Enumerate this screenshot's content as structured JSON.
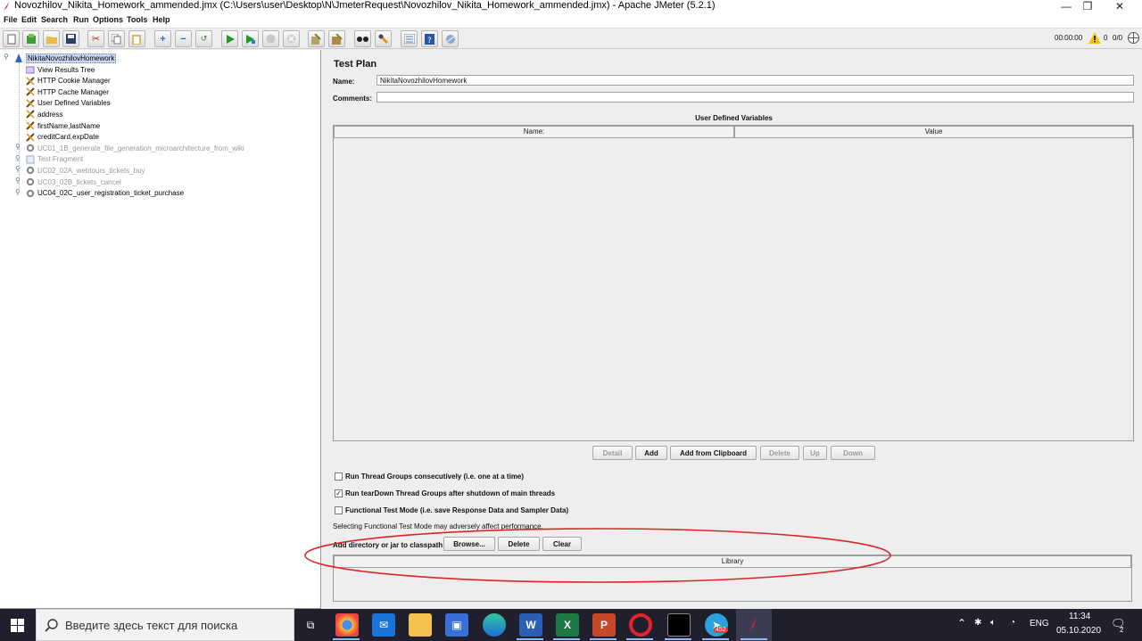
{
  "window": {
    "title": "Novozhilov_Nikita_Homework_ammended.jmx (C:\\Users\\user\\Desktop\\N\\JmeterRequest\\Novozhilov_Nikita_Homework_ammended.jmx) - Apache JMeter (5.2.1)",
    "controls": {
      "minimize": "—",
      "restore": "❐",
      "close": "✕"
    }
  },
  "menu": [
    "File",
    "Edit",
    "Search",
    "Run",
    "Options",
    "Tools",
    "Help"
  ],
  "toolbar": {
    "icons": [
      "new-icon",
      "templates-icon",
      "open-icon",
      "save-icon",
      "cut-icon",
      "copy-icon",
      "paste-icon",
      "expand-icon",
      "collapse-icon",
      "toggle-icon",
      "start-icon",
      "start-no-pause-icon",
      "stop-icon",
      "shutdown-icon",
      "clear-icon",
      "clear-all-icon",
      "search-icon",
      "reset-search-icon",
      "function-helper-icon",
      "help-icon",
      "remote-icon"
    ],
    "timer": "00:00:00",
    "warnings": "0",
    "threads": "0/0"
  },
  "tree": {
    "root": "NikitaNovozhilovHomework",
    "children": [
      {
        "label": "View Results Tree",
        "disabled": false,
        "icon": "listener-icon"
      },
      {
        "label": "HTTP Cookie Manager",
        "disabled": false,
        "icon": "config-icon"
      },
      {
        "label": "HTTP Cache Manager",
        "disabled": false,
        "icon": "config-icon"
      },
      {
        "label": "User Defined Variables",
        "disabled": false,
        "icon": "config-icon"
      },
      {
        "label": "address",
        "disabled": false,
        "icon": "config-icon"
      },
      {
        "label": "firstName,lastName",
        "disabled": false,
        "icon": "config-icon"
      },
      {
        "label": "creditCard,expDate",
        "disabled": false,
        "icon": "config-icon"
      },
      {
        "label": "UC01_1B_generate_file_generation_microarchitecture_from_wiki",
        "disabled": true,
        "icon": "thread-group-icon"
      },
      {
        "label": "Test Fragment",
        "disabled": true,
        "icon": "fragment-icon"
      },
      {
        "label": "UC02_02A_webtours_tickets_buy",
        "disabled": true,
        "icon": "thread-group-icon"
      },
      {
        "label": "UC03_02B_tickets_cancel",
        "disabled": true,
        "icon": "thread-group-icon"
      },
      {
        "label": "UC04_02C_user_registration_ticket_purchase",
        "disabled": false,
        "icon": "thread-group-icon"
      }
    ]
  },
  "panel": {
    "title": "Test Plan",
    "name_label": "Name:",
    "name_value": "NikitaNovozhilovHomework",
    "comments_label": "Comments:",
    "comments_value": "",
    "udv_title": "User Defined Variables",
    "udv_columns": [
      "Name:",
      "Value"
    ],
    "buttons": {
      "detail": "Detail",
      "add": "Add",
      "add_clipboard": "Add from Clipboard",
      "delete": "Delete",
      "up": "Up",
      "down": "Down"
    },
    "checkboxes": [
      {
        "label": "Run Thread Groups consecutively (i.e. one at a time)",
        "checked": false
      },
      {
        "label": "Run tearDown Thread Groups after shutdown of main threads",
        "checked": true
      },
      {
        "label": "Functional Test Mode (i.e. save Response Data and Sampler Data)",
        "checked": false
      }
    ],
    "functional_note": "Selecting Functional Test Mode may adversely affect performance.",
    "classpath_label": "Add directory or jar to classpath",
    "classpath_buttons": {
      "browse": "Browse...",
      "delete": "Delete",
      "clear": "Clear"
    },
    "library_header": "Library"
  },
  "taskbar": {
    "search_placeholder": "Введите здесь текст для поиска",
    "apps": [
      "task-view-icon",
      "chrome-icon",
      "mail-icon",
      "explorer-icon",
      "store-icon",
      "edge-icon",
      "word-icon",
      "excel-icon",
      "powerpoint-icon",
      "opera-icon",
      "terminal-icon",
      "telegram-icon",
      "jmeter-icon"
    ],
    "telegram_badge": "452",
    "lang": "ENG",
    "time": "11:34",
    "date": "05.10.2020",
    "notifications": "2"
  },
  "colors": {
    "annotation": "#d9262a",
    "selection": "#c9d7ef"
  }
}
